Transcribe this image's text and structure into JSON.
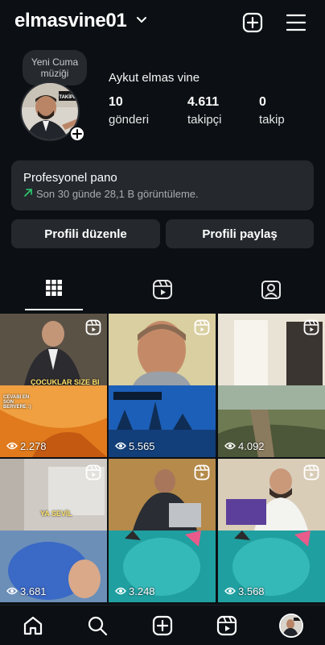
{
  "header": {
    "username": "elmasvine01",
    "icons": [
      "chevron-down-icon",
      "new-post-icon",
      "menu-icon"
    ]
  },
  "profile": {
    "note": "Yeni Cuma müziği",
    "display_name": "Aykut elmas vine",
    "stats": [
      {
        "value": "10",
        "label": "gönderi"
      },
      {
        "value": "4.611",
        "label": "takipçi"
      },
      {
        "value": "0",
        "label": "takip"
      }
    ]
  },
  "dashboard": {
    "title": "Profesyonel pano",
    "subtitle": "Son 30 günde 28,1 B görüntüleme.",
    "trend_color": "#2ecc71"
  },
  "buttons": {
    "edit": "Profili düzenle",
    "share": "Profili paylaş"
  },
  "tabs": [
    {
      "name": "grid",
      "active": true
    },
    {
      "name": "reels",
      "active": false
    },
    {
      "name": "tagged",
      "active": false
    }
  ],
  "posts": [
    {
      "views": "2.278",
      "caption_top": "ÇOCUKLAR SIZE BI",
      "caption_bottom": "CEVABI EN SON BERVERE :)"
    },
    {
      "views": "5.565",
      "caption_top": "",
      "caption_bottom": ""
    },
    {
      "views": "4.092",
      "caption_top": "",
      "caption_bottom": ""
    },
    {
      "views": "3.681",
      "caption_top": "YA SEVİL",
      "caption_bottom": ""
    },
    {
      "views": "3.248",
      "caption_top": "",
      "caption_bottom": ""
    },
    {
      "views": "3.568",
      "caption_top": "",
      "caption_bottom": ""
    }
  ],
  "bottom_nav": [
    "home-icon",
    "search-icon",
    "create-icon",
    "reels-icon",
    "profile-avatar"
  ]
}
